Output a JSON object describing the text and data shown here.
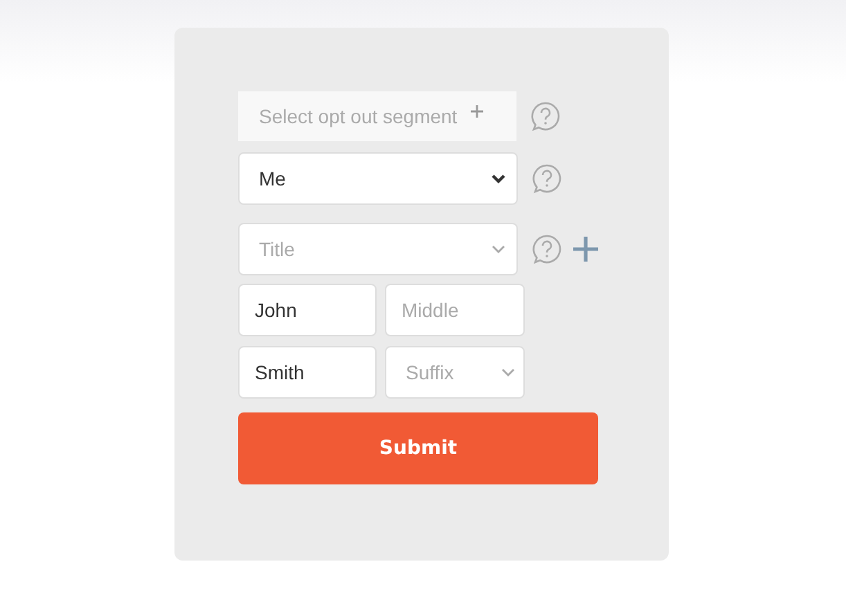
{
  "segment_field": {
    "placeholder": "Select opt out segment"
  },
  "relationship_select": {
    "value": "Me"
  },
  "title_select": {
    "placeholder": "Title"
  },
  "first_name": {
    "value": "John"
  },
  "middle_name": {
    "placeholder": "Middle"
  },
  "last_name": {
    "value": "Smith"
  },
  "suffix_select": {
    "placeholder": "Suffix"
  },
  "submit_button": {
    "label": "Submit"
  }
}
